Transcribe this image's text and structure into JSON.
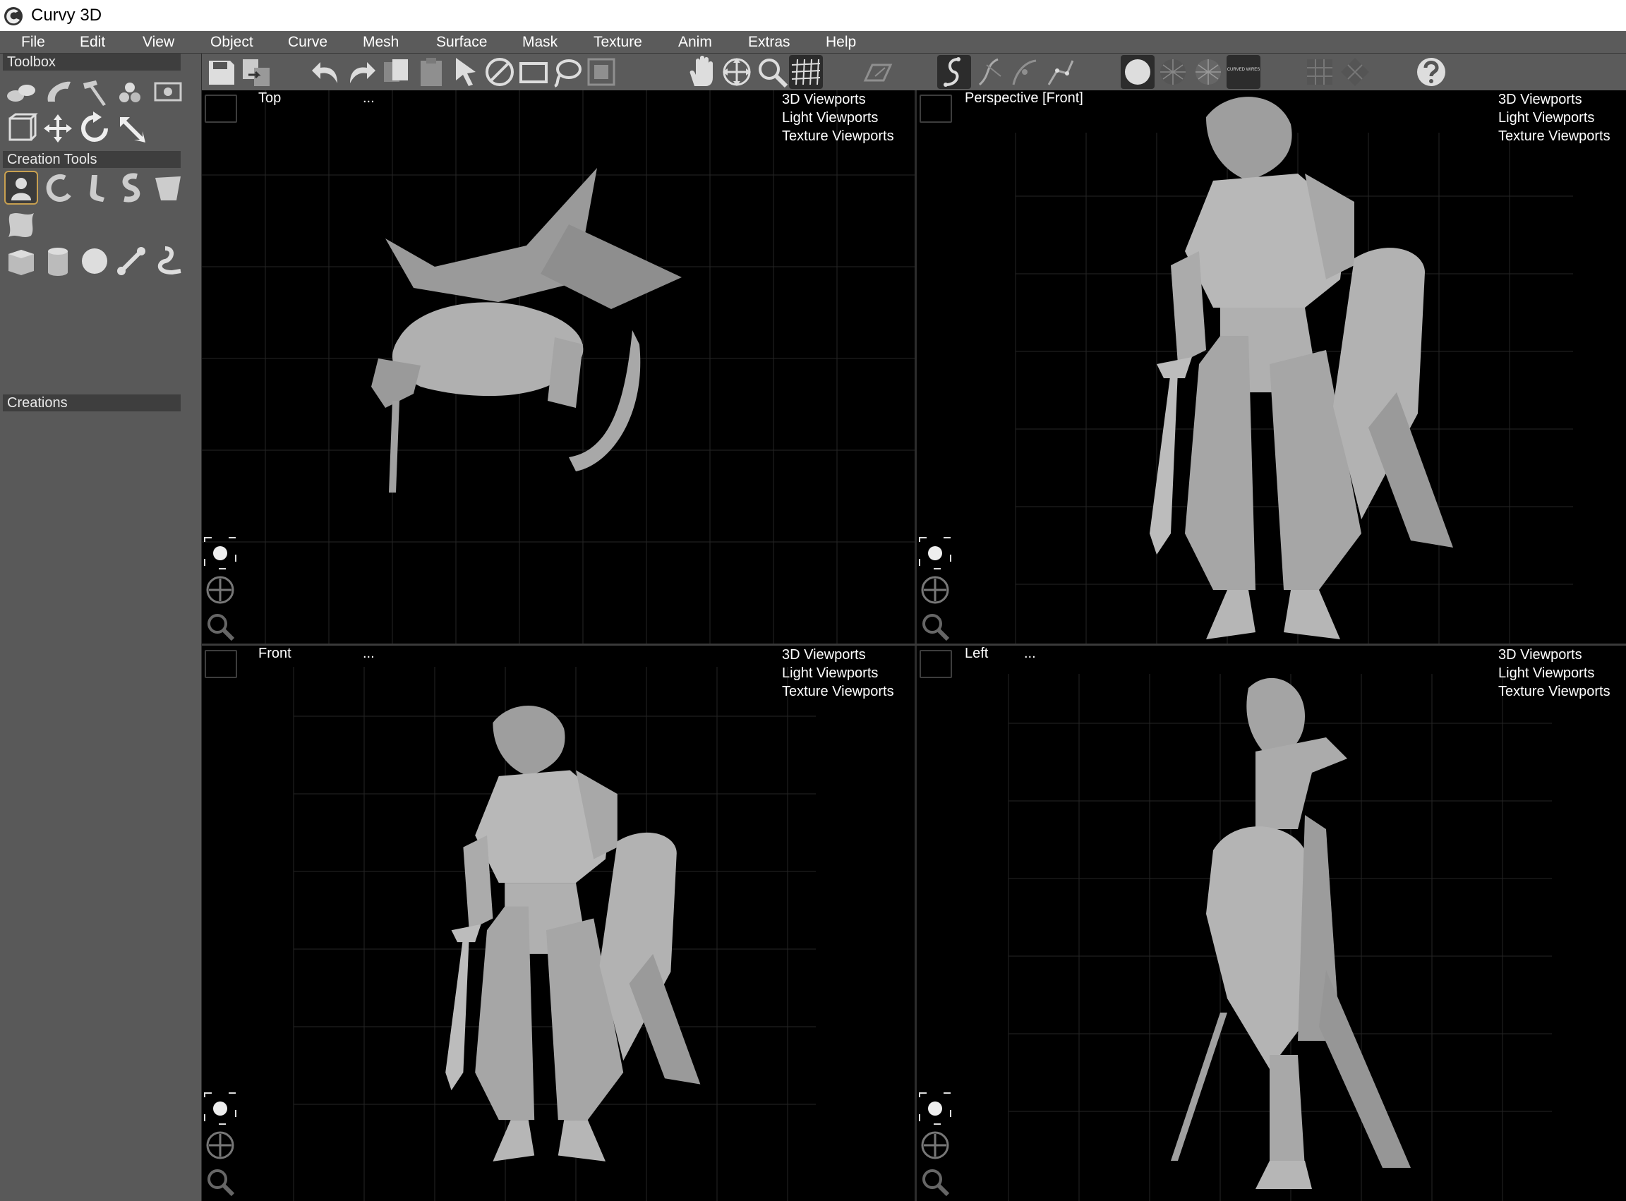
{
  "app": {
    "title": "Curvy 3D"
  },
  "menus": [
    "File",
    "Edit",
    "View",
    "Object",
    "Curve",
    "Mesh",
    "Surface",
    "Mask",
    "Texture",
    "Anim",
    "Extras",
    "Help"
  ],
  "left_panel": {
    "toolbox_label": "Toolbox",
    "creation_tools_label": "Creation Tools",
    "creations_label": "Creations"
  },
  "toolbar": {
    "curved_wires_label": "CURVED WIRES"
  },
  "viewports": [
    {
      "name": "Top",
      "dots": "...",
      "menu": [
        "3D Viewports",
        "Light Viewports",
        "Texture Viewports"
      ]
    },
    {
      "name": "Perspective [Front]",
      "dots": "",
      "menu": [
        "3D Viewports",
        "Light Viewports",
        "Texture Viewports"
      ]
    },
    {
      "name": "Front",
      "dots": "...",
      "menu": [
        "3D Viewports",
        "Light Viewports",
        "Texture Viewports"
      ]
    },
    {
      "name": "Left",
      "dots": "...",
      "menu": [
        "3D Viewports",
        "Light Viewports",
        "Texture Viewports"
      ]
    }
  ],
  "colors": {
    "accent": "#c8a050",
    "model": "#b4b4b4",
    "grid": "#2a2a2a"
  }
}
